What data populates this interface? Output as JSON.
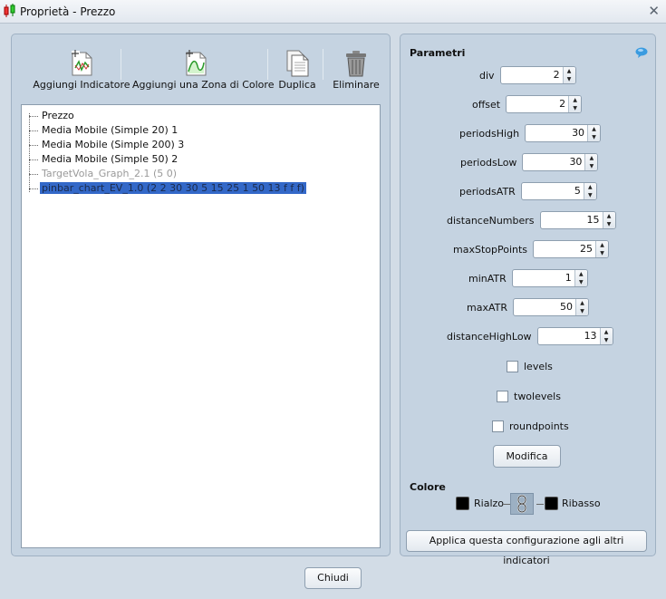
{
  "window": {
    "title": "Proprietà - Prezzo",
    "close_glyph": "✕"
  },
  "toolbar": {
    "add_indicator": "Aggiungi Indicatore",
    "add_color_zone": "Aggiungi una Zona di Colore",
    "duplicate": "Duplica",
    "delete": "Eliminare"
  },
  "tree": {
    "items": [
      {
        "label": "Prezzo",
        "state": "normal"
      },
      {
        "label": "Media Mobile (Simple 20) 1",
        "state": "normal"
      },
      {
        "label": "Media Mobile (Simple 200) 3",
        "state": "normal"
      },
      {
        "label": "Media Mobile (Simple 50) 2",
        "state": "normal"
      },
      {
        "label": "TargetVola_Graph_2.1 (5 0)",
        "state": "disabled"
      },
      {
        "label": "pinbar_chart_EV_1.0 (2 2 30 30 5 15 25 1 50 13 f f f)",
        "state": "selected"
      }
    ]
  },
  "params": {
    "title": "Parametri",
    "fields": [
      {
        "label": "div",
        "value": "2"
      },
      {
        "label": "offset",
        "value": "2"
      },
      {
        "label": "periodsHigh",
        "value": "30"
      },
      {
        "label": "periodsLow",
        "value": "30"
      },
      {
        "label": "periodsATR",
        "value": "5"
      },
      {
        "label": "distanceNumbers",
        "value": "15"
      },
      {
        "label": "maxStopPoints",
        "value": "25"
      },
      {
        "label": "minATR",
        "value": "1"
      },
      {
        "label": "maxATR",
        "value": "50"
      },
      {
        "label": "distanceHighLow",
        "value": "13"
      }
    ],
    "checkboxes": [
      {
        "label": "levels",
        "checked": false
      },
      {
        "label": "twolevels",
        "checked": false
      },
      {
        "label": "roundpoints",
        "checked": false
      }
    ],
    "modify_button": "Modifica"
  },
  "colors": {
    "title": "Colore",
    "up_label": "Rialzo",
    "down_label": "Ribasso",
    "up_color": "#000000",
    "down_color": "#000000"
  },
  "apply_button": "Applica questa configurazione agli altri indicatori",
  "close_button": "Chiudi",
  "icons": {
    "app": "candlestick-app-icon",
    "help": "help-bubble-icon",
    "link": "chain-link-icon"
  }
}
